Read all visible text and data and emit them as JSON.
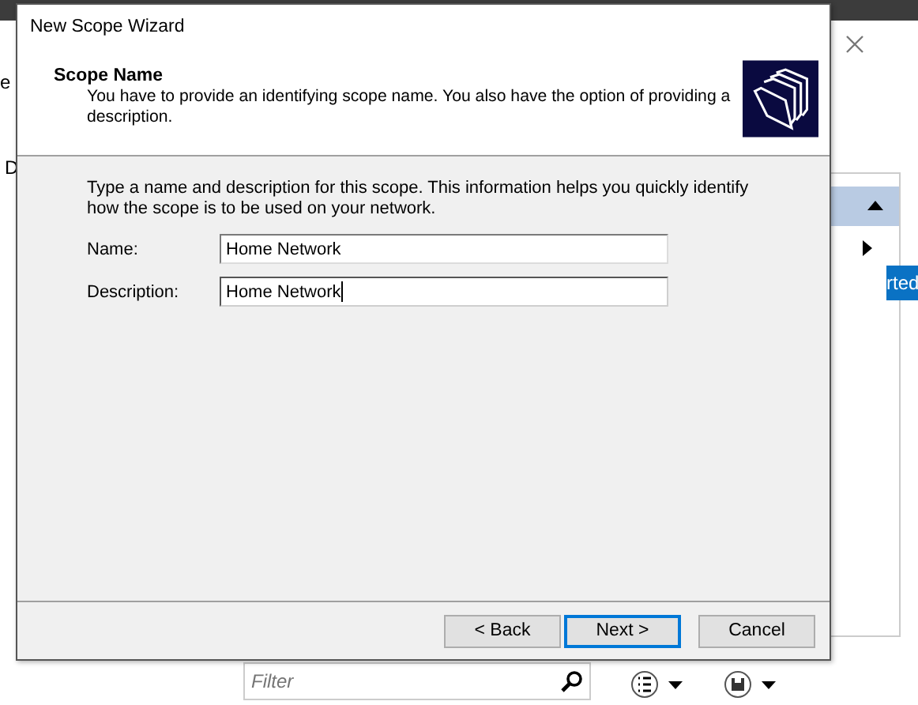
{
  "background": {
    "left_labels": [
      "e",
      "D"
    ],
    "selected_item": "rted",
    "filter": {
      "placeholder": "Filter"
    }
  },
  "dialog": {
    "title": "New Scope Wizard",
    "heading": "Scope Name",
    "subheading": "You have to provide an identifying scope name. You also have the option of providing a description.",
    "instructions": "Type a name and description for this scope. This information helps you quickly identify how the scope is to be used on your network.",
    "fields": [
      {
        "label": "Name:",
        "value": "Home Network",
        "focused": false
      },
      {
        "label": "Description:",
        "value": "Home Network",
        "focused": true
      }
    ],
    "buttons": [
      {
        "label": "< Back",
        "default": false
      },
      {
        "label": "Next >",
        "default": true
      },
      {
        "label": "Cancel",
        "default": false
      }
    ]
  }
}
